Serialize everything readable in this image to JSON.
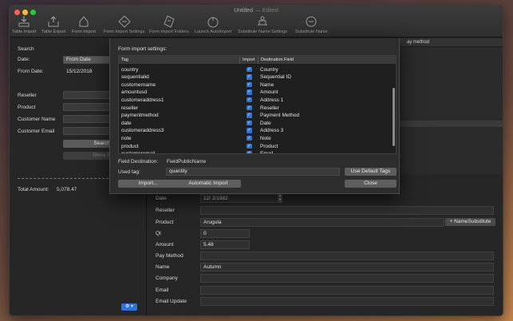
{
  "window": {
    "title": "Untitled",
    "status": "— Edited"
  },
  "toolbar": [
    {
      "label": "Table Import",
      "icon": "table-import-icon"
    },
    {
      "label": "Table Export",
      "icon": "table-export-icon"
    },
    {
      "label": "Form Import",
      "icon": "form-import-icon"
    },
    {
      "label": "Form Import Settings",
      "icon": "form-import-settings-icon"
    },
    {
      "label": "Form Import Folders",
      "icon": "form-import-folders-icon"
    },
    {
      "label": "Launch AutoImport",
      "icon": "launch-autoimport-icon"
    },
    {
      "label": "Substitute Name Settings",
      "icon": "substitute-name-settings-icon"
    },
    {
      "label": "Substitute Name",
      "icon": "substitute-name-icon"
    }
  ],
  "search": {
    "heading": "Search",
    "date_label": "Date:",
    "date_value": "From Date",
    "from_date_label": "From Date:",
    "from_date_value": "15/12/2018",
    "reseller_label": "Reseller",
    "product_label": "Product",
    "customer_name_label": "Customer Name",
    "customer_email_label": "Customer Email",
    "search_button": "Search",
    "show_all_button": "Show A"
  },
  "total": {
    "label": "Total Amount:",
    "value": "5,078.47"
  },
  "list_header": {
    "pay_method": "ay method"
  },
  "detail": {
    "date_label": "Date",
    "date_value": "12/  2/1982",
    "reseller_label": "Reseller",
    "reseller_value": "",
    "product_label": "Product",
    "product_value": "Arugula",
    "name_substitute_button": "+ NameSubstitute",
    "qt_label": "Qt",
    "qt_value": "0",
    "amount_label": "Amount",
    "amount_value": "5.48",
    "pay_method_label": "Pay Method",
    "pay_method_value": "",
    "name_label": "Name",
    "name_value": "Autumn",
    "company_label": "Company",
    "company_value": "",
    "email_label": "Email",
    "email_value": "",
    "email_update_label": "Email Update",
    "email_update_value": ""
  },
  "sheet": {
    "title": "Form import settings:",
    "columns": {
      "tag": "Tag",
      "import": "Import",
      "destination": "Destination Field"
    },
    "rows": [
      {
        "tag": "country",
        "import": true,
        "destination": "Country"
      },
      {
        "tag": "sequentialid",
        "import": true,
        "destination": "Sequential ID"
      },
      {
        "tag": "customername",
        "import": true,
        "destination": "Name"
      },
      {
        "tag": "amountusd",
        "import": true,
        "destination": "Amount"
      },
      {
        "tag": "customeraddress1",
        "import": true,
        "destination": "Address 1"
      },
      {
        "tag": "reseller",
        "import": true,
        "destination": "Reseller"
      },
      {
        "tag": "paymentmethod",
        "import": true,
        "destination": "Payment Method"
      },
      {
        "tag": "date",
        "import": true,
        "destination": "Date"
      },
      {
        "tag": "customeraddress3",
        "import": true,
        "destination": "Address 3"
      },
      {
        "tag": "note",
        "import": true,
        "destination": "Note"
      },
      {
        "tag": "product",
        "import": true,
        "destination": "Product"
      },
      {
        "tag": "customeremail",
        "import": true,
        "destination": "Email"
      }
    ],
    "field_destination_label": "Field Destination:",
    "field_destination_value": "FieldPublicName",
    "used_tag_label": "Used tag:",
    "used_tag_value": "quantity",
    "use_default_tags_button": "Use Default Tags",
    "import_button": "Import...",
    "automatic_import_button": "Automatic Import",
    "close_button": "Close"
  },
  "colors": {
    "accent": "#2f73d8",
    "window_bg": "#252525"
  }
}
